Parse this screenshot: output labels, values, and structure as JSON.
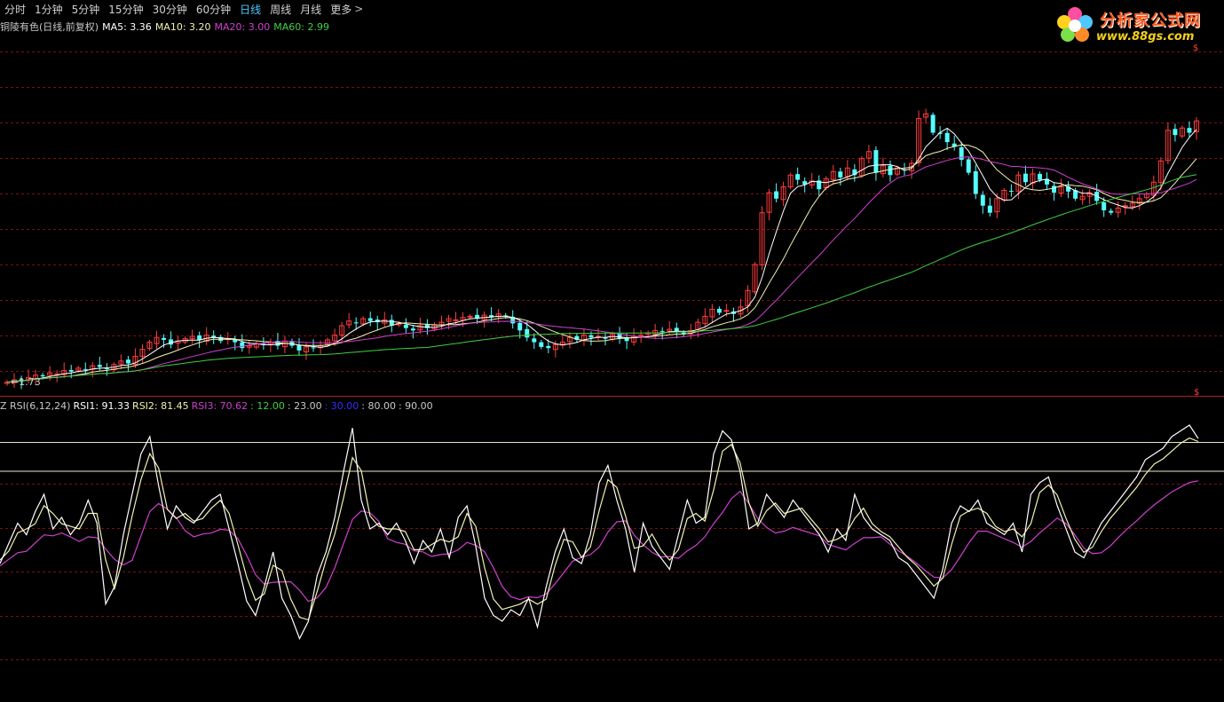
{
  "periods": [
    "分时",
    "1分钟",
    "5分钟",
    "15分钟",
    "30分钟",
    "60分钟",
    "日线",
    "周线",
    "月线",
    "更多"
  ],
  "active_period": "日线",
  "more_arrow": ">",
  "logo": {
    "text": "分析家公式网",
    "url": "www.88gs.com"
  },
  "ma_legend": [
    {
      "text": "铜陵有色(日线,前复权)",
      "color": "#c8c8c8"
    },
    {
      "text": "MA5: 3.36",
      "color": "#ffffff"
    },
    {
      "text": "MA10: 3.20",
      "color": "#f2f2b0"
    },
    {
      "text": "MA20: 3.00",
      "color": "#d040d0"
    },
    {
      "text": "MA60: 2.99",
      "color": "#40d040"
    }
  ],
  "low_marker": "←1.73",
  "dollar_sign": "$",
  "rsi_legend": [
    {
      "text": "Z RSI(6,12,24)",
      "color": "#c8c8c8"
    },
    {
      "text": "RSI1: 91.33",
      "color": "#ffffff"
    },
    {
      "text": "RSI2: 81.45",
      "color": "#f2f2b0"
    },
    {
      "text": "RSI3: 70.62",
      "color": "#d040d0"
    },
    {
      "text": ": 12.00",
      "color": "#40d040"
    },
    {
      "text": ": 23.00",
      "color": "#c8c8c8"
    },
    {
      "text": ": 30.00",
      "color": "#3030ff"
    },
    {
      "text": ": 80.00",
      "color": "#c8c8c8"
    },
    {
      "text": ": 90.00",
      "color": "#c8c8c8"
    }
  ],
  "chart_data": {
    "type": "candlestick",
    "title": "铜陵有色(日线,前复权)",
    "colors": {
      "up": "#ff3c3c",
      "down": "#54ffff",
      "ma5": "#ffffff",
      "ma10": "#f2f2b0",
      "ma20": "#d040d0",
      "ma60": "#40d040",
      "rsi1": "#ffffff",
      "rsi2": "#f2f2b0",
      "rsi3": "#d040d0"
    },
    "price_range": [
      1.7,
      4.55
    ],
    "close": [
      1.74,
      1.76,
      1.75,
      1.78,
      1.8,
      1.79,
      1.82,
      1.81,
      1.84,
      1.83,
      1.86,
      1.85,
      1.88,
      1.87,
      1.85,
      1.89,
      1.92,
      1.9,
      1.96,
      2.02,
      2.08,
      2.12,
      2.1,
      2.06,
      2.09,
      2.11,
      2.13,
      2.1,
      2.14,
      2.12,
      2.09,
      2.11,
      2.08,
      2.03,
      2.05,
      2.07,
      2.06,
      2.08,
      2.05,
      2.09,
      2.05,
      2.01,
      2.04,
      2.03,
      2.05,
      2.1,
      2.14,
      2.22,
      2.26,
      2.24,
      2.28,
      2.26,
      2.25,
      2.27,
      2.22,
      2.24,
      2.2,
      2.18,
      2.22,
      2.2,
      2.23,
      2.25,
      2.28,
      2.27,
      2.29,
      2.3,
      2.28,
      2.31,
      2.29,
      2.32,
      2.3,
      2.24,
      2.18,
      2.12,
      2.08,
      2.04,
      2.03,
      2.06,
      2.08,
      2.12,
      2.1,
      2.14,
      2.12,
      2.13,
      2.11,
      2.15,
      2.11,
      2.09,
      2.13,
      2.14,
      2.16,
      2.18,
      2.17,
      2.19,
      2.17,
      2.15,
      2.18,
      2.25,
      2.3,
      2.36,
      2.33,
      2.35,
      2.32,
      2.38,
      2.52,
      2.74,
      3.18,
      3.35,
      3.3,
      3.4,
      3.5,
      3.46,
      3.42,
      3.45,
      3.38,
      3.47,
      3.53,
      3.48,
      3.56,
      3.5,
      3.64,
      3.7,
      3.52,
      3.58,
      3.5,
      3.56,
      3.54,
      3.6,
      3.98,
      4.02,
      3.86,
      3.85,
      3.78,
      3.74,
      3.63,
      3.52,
      3.34,
      3.24,
      3.18,
      3.3,
      3.37,
      3.36,
      3.5,
      3.44,
      3.51,
      3.46,
      3.42,
      3.35,
      3.4,
      3.36,
      3.3,
      3.32,
      3.35,
      3.28,
      3.2,
      3.18,
      3.22,
      3.24,
      3.26,
      3.3,
      3.34,
      3.44,
      3.62,
      3.88,
      3.84,
      3.9,
      3.86,
      3.96
    ]
  },
  "rsi_range": [
    0,
    100
  ],
  "rsi_ref_lines": [
    80,
    90
  ],
  "rsi1": [
    48,
    55,
    62,
    58,
    66,
    72,
    60,
    64,
    58,
    62,
    70,
    62,
    34,
    40,
    58,
    72,
    86,
    92,
    75,
    60,
    68,
    64,
    62,
    66,
    70,
    72,
    60,
    48,
    35,
    30,
    40,
    52,
    36,
    30,
    22,
    28,
    44,
    52,
    64,
    80,
    95,
    70,
    60,
    62,
    58,
    62,
    56,
    48,
    56,
    52,
    60,
    50,
    64,
    68,
    54,
    36,
    30,
    28,
    32,
    30,
    36,
    26,
    40,
    52,
    60,
    50,
    48,
    58,
    76,
    82,
    70,
    60,
    45,
    62,
    54,
    50,
    46,
    58,
    70,
    62,
    64,
    86,
    94,
    91,
    80,
    60,
    62,
    72,
    68,
    64,
    70,
    66,
    62,
    58,
    52,
    60,
    56,
    72,
    64,
    60,
    58,
    56,
    50,
    48,
    44,
    40,
    36,
    46,
    62,
    68,
    66,
    70,
    62,
    60,
    58,
    62,
    52,
    72,
    76,
    78,
    68,
    60,
    52,
    50,
    56,
    62,
    66,
    70,
    74,
    78,
    84,
    86,
    88,
    92,
    94,
    96,
    91.33
  ]
}
